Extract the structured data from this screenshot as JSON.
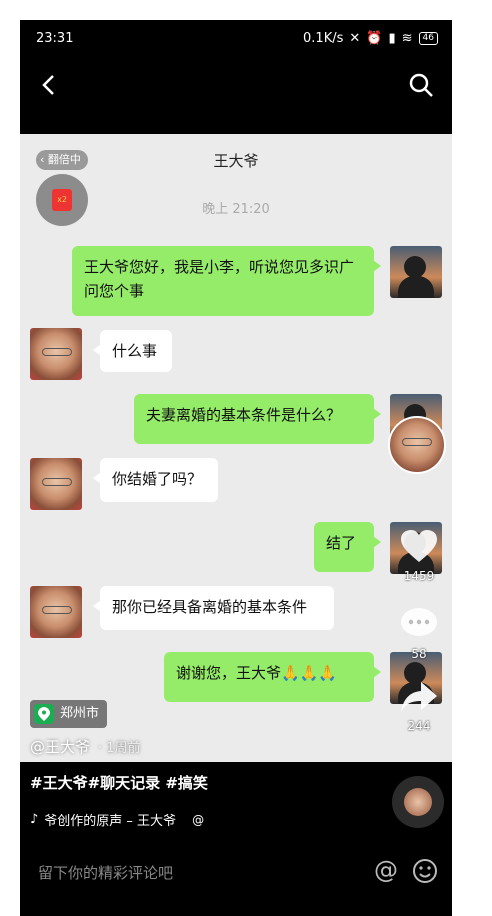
{
  "status_bar": {
    "time": "23:31",
    "network_speed": "0.1K/s",
    "battery": "46"
  },
  "chat": {
    "header_pill": "翻倍中",
    "title": "王大爷",
    "timestamp": "晚上 21:20",
    "redpack_label": "x2",
    "messages": [
      {
        "side": "right",
        "text": "王大爷您好，我是小李，听说您见多识广问您个事"
      },
      {
        "side": "left",
        "text": "什么事"
      },
      {
        "side": "right",
        "text": "夫妻离婚的基本条件是什么？"
      },
      {
        "side": "left",
        "text": "你结婚了吗？"
      },
      {
        "side": "right",
        "text": "结了"
      },
      {
        "side": "left",
        "text": "那你已经具备离婚的基本条件"
      },
      {
        "side": "right",
        "text": "谢谢您，王大爷🙏🙏🙏"
      }
    ]
  },
  "side_actions": {
    "likes": "1459",
    "comments": "58",
    "shares": "244"
  },
  "location": "郑州市",
  "author": {
    "handle": "@王大爷",
    "ago": "· 1周前"
  },
  "caption": "#王大爷#聊天记录 #搞笑",
  "music": "爷创作的原声 – 王大爷",
  "music_suffix": "@",
  "comment_bar": {
    "placeholder": "留下你的精彩评论吧",
    "at_symbol": "@"
  },
  "colors": {
    "bubble_green": "#95ec69",
    "like_color": "#ffffff",
    "location_pin": "#1aad52"
  }
}
